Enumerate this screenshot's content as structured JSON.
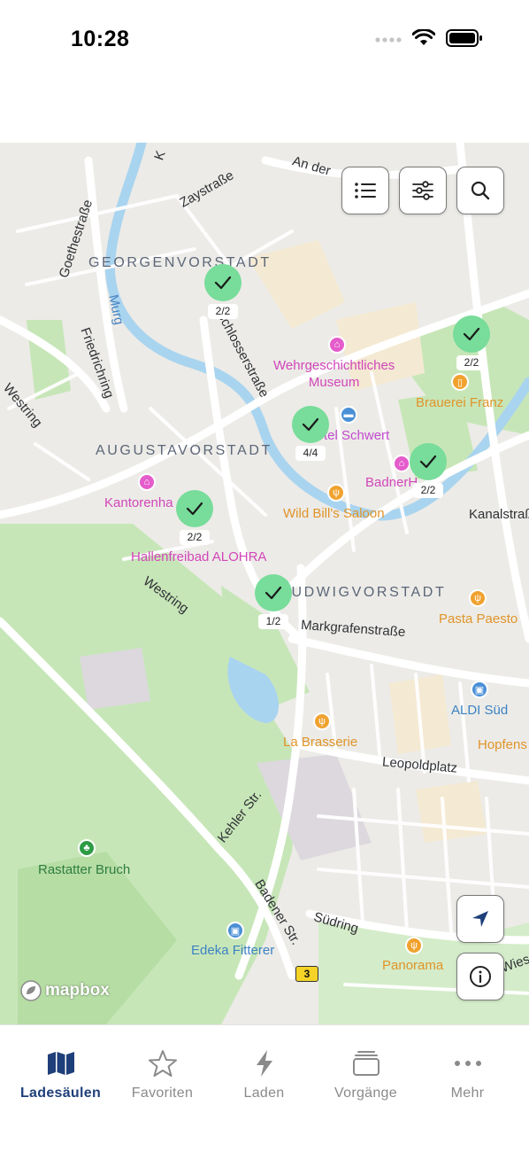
{
  "status_bar": {
    "time": "10:28"
  },
  "map": {
    "districts": {
      "georgenvorstadt": "GEORGENVORSTADT",
      "augustavorstadt": "AUGUSTAVORSTADT",
      "ludwigvorstadt": "LUDWIGVORSTADT"
    },
    "streets": {
      "zaystrasse": "Zaystraße",
      "goethestrasse": "Goethestraße",
      "friedrichring": "Friedrichring",
      "westring_top": "Westring",
      "westring_bottom": "Westring",
      "schlosserstrasse": "Schlosserstraße",
      "markgrafenstrasse": "Markgrafenstraße",
      "kanalstrasse": "Kanalstraß",
      "leopoldplatz": "Leopoldplatz",
      "kehler_str": "Kehler Str.",
      "badener_str": "Badener Str.",
      "suedring": "Südring",
      "an_der": "An der",
      "murg": "Murg",
      "wies": "Wies",
      "k": "K",
      "route_number": "3"
    },
    "pois": {
      "museum": "Wehrgeschichtliches Museum",
      "museum_line1": "Wehrgeschichtliches",
      "museum_line2": "Museum",
      "brauerei": "Brauerei Franz",
      "hotel": "tel Schwert",
      "badner": "BadnerH",
      "kantorenhaus": "Kantorenha",
      "wild_bills": "Wild Bill's Saloon",
      "hallenfreibad": "Hallenfreibad ALOHRA",
      "pasta": "Pasta Paesto",
      "aldi": "ALDI Süd",
      "hopfens": "Hopfens",
      "brasserie": "La Brasserie",
      "rastatter_bruch": "Rastatter Bruch",
      "edeka": "Edeka Fitterer",
      "panorama": "Panorama"
    },
    "markers": [
      {
        "count": "2/2"
      },
      {
        "count": "2/2"
      },
      {
        "count": "4/4"
      },
      {
        "count": "2/2"
      },
      {
        "count": "2/2"
      },
      {
        "count": "1/2"
      }
    ],
    "attribution": "mapbox"
  },
  "buttons": {
    "list": "list-icon",
    "filter": "sliders-icon",
    "search": "search-icon",
    "locate": "location-arrow-icon",
    "info": "info-icon"
  },
  "tabs": [
    {
      "label": "Ladesäulen",
      "icon": "map-icon",
      "active": true
    },
    {
      "label": "Favoriten",
      "icon": "star-icon",
      "active": false
    },
    {
      "label": "Laden",
      "icon": "bolt-icon",
      "active": false
    },
    {
      "label": "Vorgänge",
      "icon": "stack-icon",
      "active": false
    },
    {
      "label": "Mehr",
      "icon": "more-icon",
      "active": false
    }
  ],
  "colors": {
    "accent": "#1f3f7a",
    "marker": "#78dc9a",
    "water": "#a9d4ef",
    "park": "#c7e6b8",
    "map_bg": "#ecebe7",
    "tab_inactive": "#8a8a8a"
  }
}
